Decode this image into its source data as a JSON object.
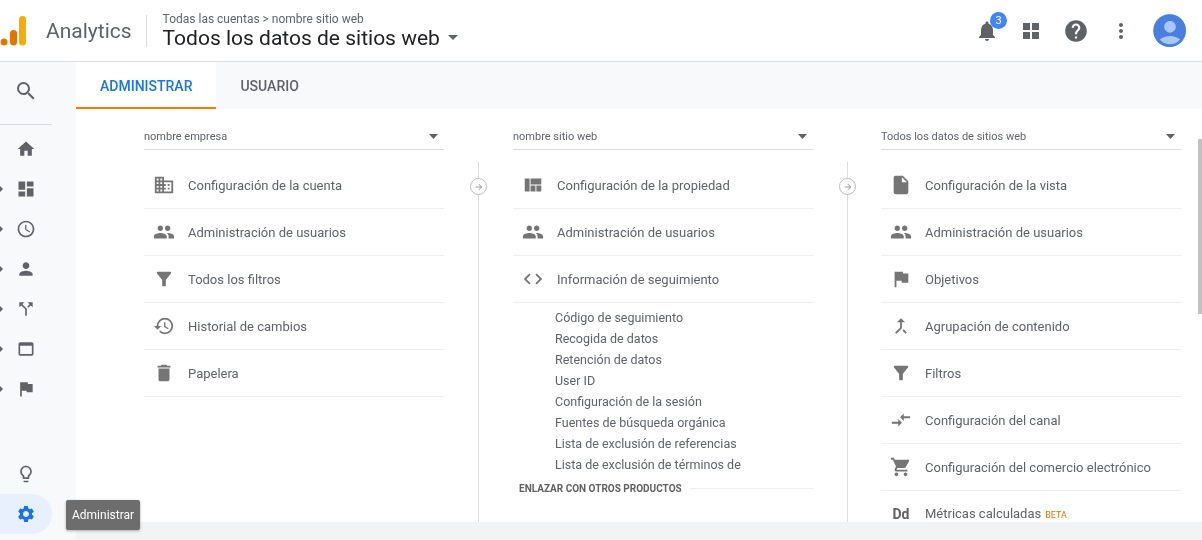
{
  "header": {
    "product": "Analytics",
    "breadcrumb": [
      "Todas las cuentas",
      "nombre sitio web"
    ],
    "breadcrumb_separator": ">",
    "view_title": "Todos los datos de sitios web",
    "notification_count": "3"
  },
  "sidebar": {
    "items": [
      {
        "selected": false,
        "expandable": false
      },
      {
        "selected": false,
        "expandable": true
      },
      {
        "selected": false,
        "expandable": true
      },
      {
        "selected": false,
        "expandable": true
      },
      {
        "selected": false,
        "expandable": true
      },
      {
        "selected": false,
        "expandable": true
      },
      {
        "selected": false,
        "expandable": true
      }
    ],
    "bottom_items": [
      {
        "selected": false
      },
      {
        "selected": true
      }
    ],
    "tooltip": "Administrar"
  },
  "tabs": [
    {
      "label": "ADMINISTRAR",
      "selected": true
    },
    {
      "label": "USUARIO",
      "selected": false
    }
  ],
  "columns": [
    {
      "dropdown": "nombre empresa",
      "items": [
        {
          "label": "Configuración de la cuenta"
        },
        {
          "label": "Administración de usuarios"
        },
        {
          "label": "Todos los filtros"
        },
        {
          "label": "Historial de cambios"
        },
        {
          "label": "Papelera"
        }
      ]
    },
    {
      "dropdown": "nombre sitio web",
      "items": [
        {
          "label": "Configuración de la propiedad"
        },
        {
          "label": "Administración de usuarios"
        },
        {
          "label": "Información de seguimiento",
          "children": [
            {
              "label": "Código de seguimiento"
            },
            {
              "label": "Recogida de datos"
            },
            {
              "label": "Retención de datos"
            },
            {
              "label": "User ID"
            },
            {
              "label": "Configuración de la sesión"
            },
            {
              "label": "Fuentes de búsqueda orgánica"
            },
            {
              "label": "Lista de exclusión de referencias"
            },
            {
              "label": "Lista de exclusión de términos de"
            }
          ]
        }
      ],
      "section_heading": "ENLAZAR CON OTROS PRODUCTOS"
    },
    {
      "dropdown": "Todos los datos de sitios web",
      "items": [
        {
          "label": "Configuración de la vista"
        },
        {
          "label": "Administración de usuarios"
        },
        {
          "label": "Objetivos"
        },
        {
          "label": "Agrupación de contenido"
        },
        {
          "label": "Filtros"
        },
        {
          "label": "Configuración del canal"
        },
        {
          "label": "Configuración del comercio electrónico"
        },
        {
          "label": "Métricas calculadas",
          "glyph": "Dd",
          "tag": "BETA"
        }
      ]
    }
  ]
}
